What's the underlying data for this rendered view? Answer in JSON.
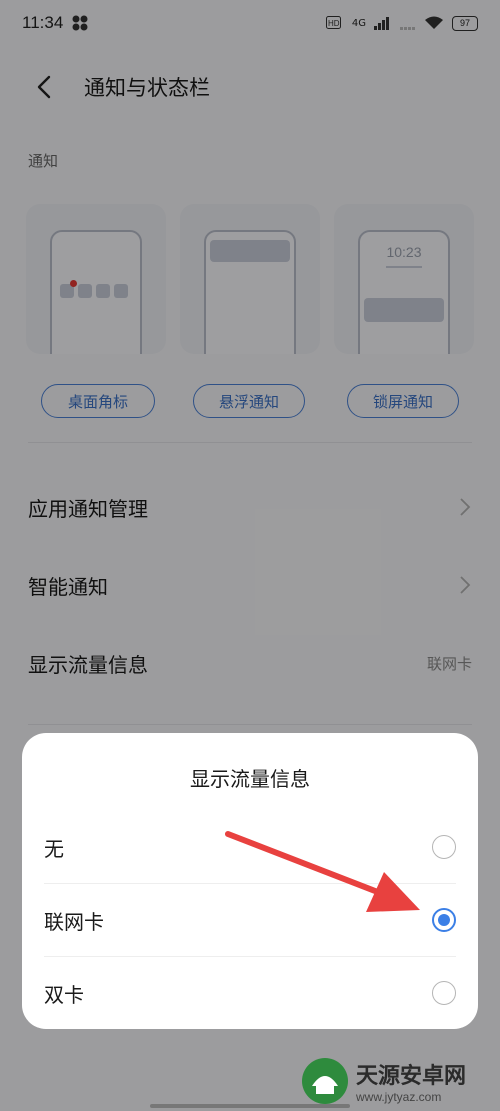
{
  "status_bar": {
    "time": "11:34",
    "network": "4G",
    "battery": "97",
    "icons": [
      "app-icon",
      "hd-icon",
      "signal-icon",
      "wifi-icon",
      "battery-icon"
    ]
  },
  "header": {
    "title": "通知与状态栏"
  },
  "section": {
    "label": "通知"
  },
  "previews": {
    "lock_time": "10:23",
    "pills": [
      "桌面角标",
      "悬浮通知",
      "锁屏通知"
    ]
  },
  "settings": {
    "items": [
      {
        "label": "应用通知管理"
      },
      {
        "label": "智能通知"
      },
      {
        "label": "显示流量信息",
        "value": "联网卡"
      }
    ]
  },
  "dialog": {
    "title": "显示流量信息",
    "options": [
      {
        "label": "无",
        "selected": false
      },
      {
        "label": "联网卡",
        "selected": true
      },
      {
        "label": "双卡",
        "selected": false
      }
    ]
  },
  "watermark": {
    "name": "天源安卓网",
    "url": "www.jytyaz.com"
  },
  "colors": {
    "accent": "#3b7fe6",
    "arrow": "#e8413f",
    "badge_dot": "#e53935"
  }
}
